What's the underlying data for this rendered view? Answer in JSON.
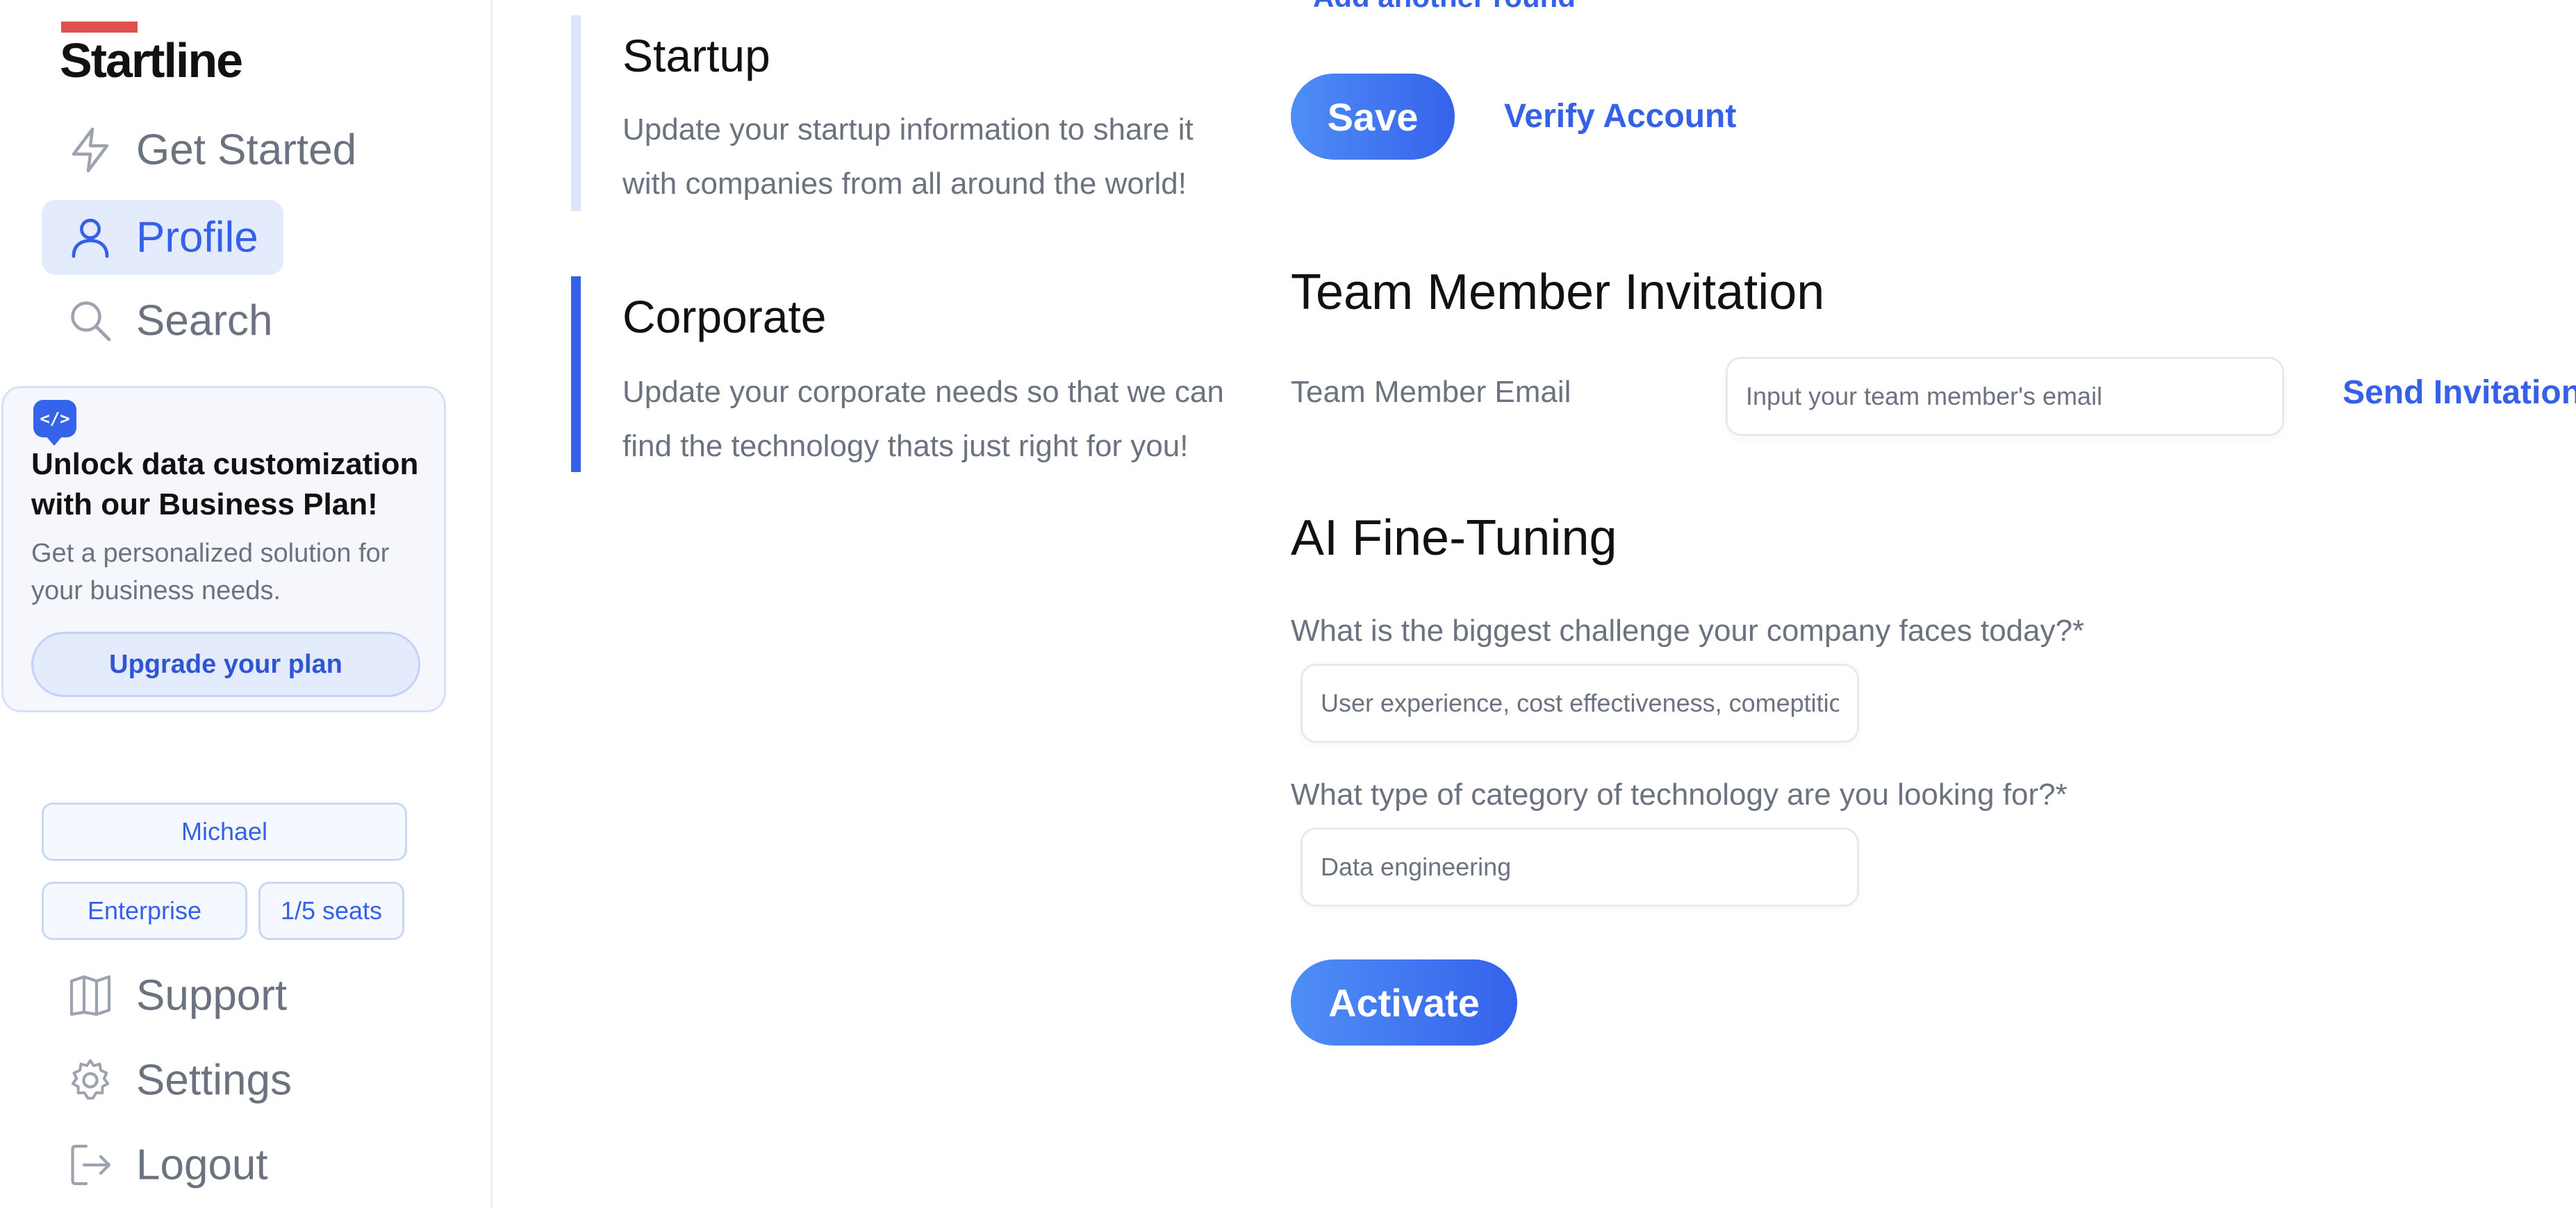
{
  "app": {
    "logo": "Startline",
    "accent": "#3461e8",
    "logo_accent": "#e0504c"
  },
  "sidebar": {
    "nav_top": [
      {
        "label": "Get Started",
        "icon": "lightning-icon",
        "active": false
      },
      {
        "label": "Profile",
        "icon": "user-icon",
        "active": true
      },
      {
        "label": "Search",
        "icon": "search-icon",
        "active": false
      }
    ],
    "promo": {
      "badge_icon": "code-icon",
      "badge_text": "</>",
      "title": "Unlock data customization with our Business Plan!",
      "text": "Get a personalized solution for your business needs.",
      "button": "Upgrade your plan"
    },
    "account": {
      "user": "Michael",
      "plan": "Enterprise",
      "seats": "1/5 seats"
    },
    "nav_bottom": [
      {
        "label": "Support",
        "icon": "book-icon"
      },
      {
        "label": "Settings",
        "icon": "gear-icon"
      },
      {
        "label": "Logout",
        "icon": "logout-icon"
      }
    ]
  },
  "sections": [
    {
      "title": "Startup",
      "description": "Update your startup information to share it with companies from all around the world!",
      "active": false
    },
    {
      "title": "Corporate",
      "description": "Update your corporate needs so that we can find the technology thats just right for you!",
      "active": true
    }
  ],
  "main": {
    "add_round_link": "Add another round",
    "save_button": "Save",
    "verify_link": "Verify Account",
    "team": {
      "heading": "Team Member Invitation",
      "email_label": "Team Member Email",
      "email_placeholder": "Input your team member's email",
      "send_button": "Send Invitation"
    },
    "ai": {
      "heading": "AI Fine-Tuning",
      "q1_label": "What is the biggest challenge your company faces today?*",
      "q1_value": "User experience, cost effectiveness, comeptition",
      "q2_label": "What type of category of technology are you looking for?*",
      "q2_value": "Data engineering",
      "activate_button": "Activate"
    }
  }
}
